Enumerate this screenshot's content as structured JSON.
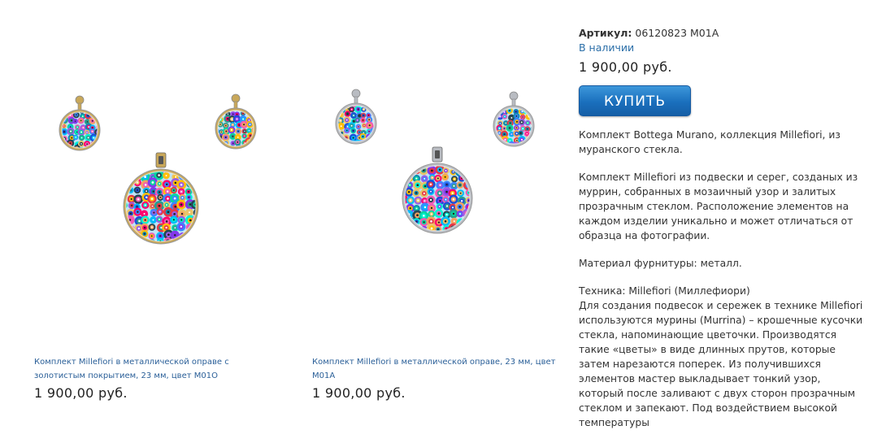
{
  "products": [
    {
      "title": "Комплект Millefiori в металлической оправе с золотистым покрытием, 23 мм, цвет M01O",
      "price": "1 900,00 руб.",
      "metal_color": "#c9a85a"
    },
    {
      "title": "Комплект Millefiori в металлической оправе, 23 мм, цвет M01A",
      "price": "1 900,00 руб.",
      "metal_color": "#b9bcc2"
    }
  ],
  "details": {
    "sku_label": "Артикул:",
    "sku_value": "06120823 M01A",
    "stock": "В наличии",
    "price": "1 900,00 руб.",
    "buy_label": "КУПИТЬ",
    "intro": "Комплект Bottega Murano, коллекция Millefiori, из муранского стекла.",
    "composition": "Комплект Millefiori из подвески и серег, созданых из муррин, собранных в мозаичный узор и залитых прозрачным стеклом. Расположение элементов на каждом изделии уникально и может отличаться от образца на фотографии.",
    "material": "Материал фурнитуры: металл.",
    "technique_title": "Техника: Millefiori (Миллефиори)",
    "technique_text": "Для создания подвесок и сережек в технике Millefiori используются мурины (Murrina) – крошечные кусочки стекла, напоминающие цветочки. Производятся такие «цветы» в виде длинных прутов, которые затем нарезаются поперек. Из получившихся элементов мастер выкладывает тонкий узор, который после заливают с двух сторон прозрачным стеклом и запекают. Под воздействием высокой температуры"
  },
  "colors": {
    "link": "#2a5f98",
    "stock": "#2a6ea8",
    "button": "#1a6fbd"
  },
  "icons": [
    "earring-left-icon",
    "earring-right-icon",
    "pendant-icon"
  ]
}
